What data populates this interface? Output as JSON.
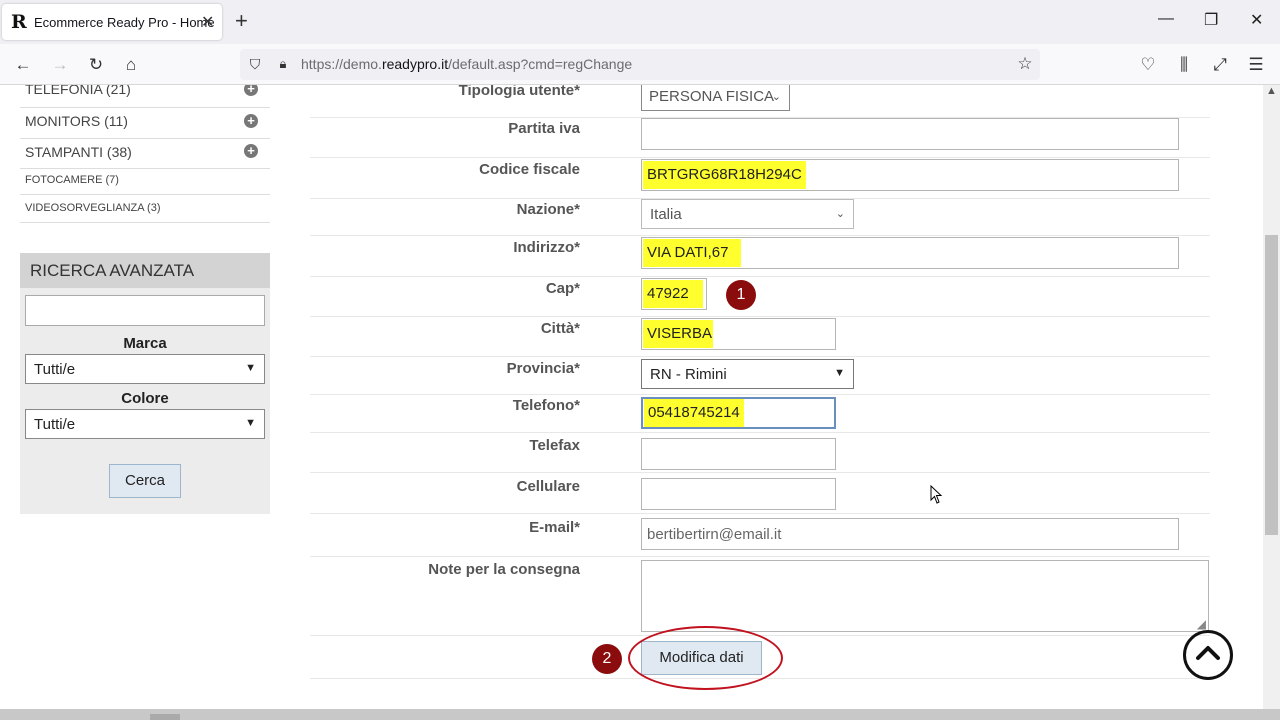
{
  "browser": {
    "tab_title": "Ecommerce Ready Pro - Home",
    "favicon": "R",
    "url_prefix": "https://demo.",
    "url_domain": "readypro.it",
    "url_path": "/default.asp?cmd=regChange"
  },
  "sidebar": {
    "categories": [
      {
        "label": "TELEFONIA (21)",
        "expandable": true
      },
      {
        "label": "MONITORS (11)",
        "expandable": true
      },
      {
        "label": "STAMPANTI (38)",
        "expandable": true
      },
      {
        "label": "FOTOCAMERE (7)",
        "expandable": false
      },
      {
        "label": "VIDEOSORVEGLIANZA (3)",
        "expandable": false
      }
    ],
    "advanced_search": {
      "title": "RICERCA AVANZATA",
      "search_value": "",
      "brand_label": "Marca",
      "brand_value": "Tutti/e",
      "color_label": "Colore",
      "color_value": "Tutti/e",
      "search_button": "Cerca"
    }
  },
  "form": {
    "fields": [
      {
        "label": "Tipologia utente*",
        "value": "PERSONA FISICA"
      },
      {
        "label": "Partita iva",
        "value": ""
      },
      {
        "label": "Codice fiscale",
        "value": "BRTGRG68R18H294C"
      },
      {
        "label": "Nazione*",
        "value": "Italia"
      },
      {
        "label": "Indirizzo*",
        "value": "VIA DATI,67"
      },
      {
        "label": "Cap*",
        "value": "47922"
      },
      {
        "label": "Città*",
        "value": "VISERBA"
      },
      {
        "label": "Provincia*",
        "value": "RN - Rimini"
      },
      {
        "label": "Telefono*",
        "value": "05418745214"
      },
      {
        "label": "Telefax",
        "value": ""
      },
      {
        "label": "Cellulare",
        "value": ""
      },
      {
        "label": "E-mail*",
        "value": "bertibertirn@email.it"
      },
      {
        "label": "Note per la consegna",
        "value": ""
      }
    ],
    "submit_label": "Modifica dati"
  },
  "annotations": {
    "step1": "1",
    "step2": "2",
    "highlight_color": "#ffff2e",
    "marker_color": "#8b0c0c",
    "ring_color": "#c1121f"
  }
}
